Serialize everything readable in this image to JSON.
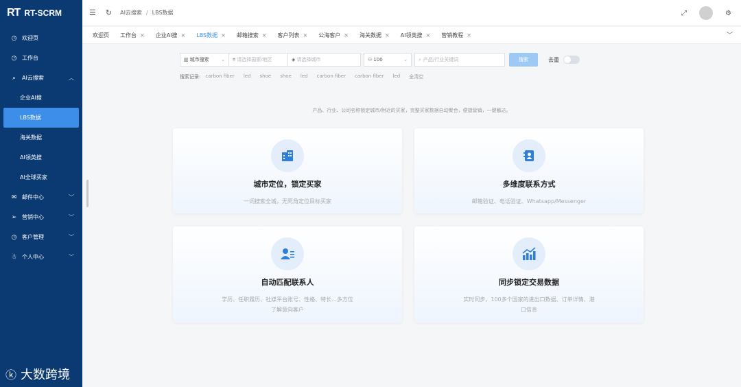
{
  "app": {
    "logo_mark": "RT",
    "logo_text": "RT-SCRM"
  },
  "sidebar": {
    "items": [
      {
        "label": "欢迎页",
        "icon": "clock-icon"
      },
      {
        "label": "工作台",
        "icon": "clock-icon"
      },
      {
        "label": "AI云搜索",
        "icon": "search-icon",
        "expanded": true
      },
      {
        "label": "企业AI搜"
      },
      {
        "label": "LBS数据",
        "active": true
      },
      {
        "label": "海关数据"
      },
      {
        "label": "AI领英搜"
      },
      {
        "label": "AI全球买家"
      },
      {
        "label": "邮件中心",
        "icon": "mail-icon"
      },
      {
        "label": "营销中心",
        "icon": "send-icon"
      },
      {
        "label": "客户管理",
        "icon": "clock-icon"
      },
      {
        "label": "个人中心",
        "icon": "person-icon"
      }
    ]
  },
  "topbar": {
    "breadcrumb": [
      "AI云搜索",
      "LBS数据"
    ]
  },
  "tabs": [
    {
      "label": "欢迎页",
      "closable": false
    },
    {
      "label": "工作台",
      "closable": true
    },
    {
      "label": "企业AI搜",
      "closable": true
    },
    {
      "label": "LBS数据",
      "closable": true,
      "active": true
    },
    {
      "label": "邮箱搜索",
      "closable": true
    },
    {
      "label": "客户列表",
      "closable": true
    },
    {
      "label": "公海客户",
      "closable": true
    },
    {
      "label": "海关数据",
      "closable": true
    },
    {
      "label": "AI领英搜",
      "closable": true
    },
    {
      "label": "营销教程",
      "closable": true
    }
  ],
  "search": {
    "mode_label": "城市搜索",
    "country_placeholder": "请选择国家/地区",
    "city_placeholder": "请选择城市",
    "count_value": "100",
    "keyword_placeholder": "产品/行业关键词",
    "search_button": "搜索",
    "dedup_label": "去重"
  },
  "history": {
    "label": "搜索记录:",
    "items": [
      "carbon fiber",
      "led",
      "shoe",
      "shoe",
      "led",
      "carbon fiber",
      "carbon fiber",
      "led"
    ],
    "clear": "全清空"
  },
  "intro": "产品、行业、公司名称锁定城市/附近的买家，完整买家数据自动聚合，便捷营销，一键触达。",
  "cards": [
    {
      "title": "城市定位，锁定买家",
      "desc": "一词搜索全城，无死角定位目标买家",
      "icon": "building-icon"
    },
    {
      "title": "多维度联系方式",
      "desc": "邮箱验证、电话验证、Whatsapp/Messenger",
      "icon": "contact-book-icon"
    },
    {
      "title": "自动匹配联系人",
      "desc": "学历、任职履历、社媒平台账号、性格、特长...多方位了解意向客户",
      "icon": "user-list-icon"
    },
    {
      "title": "同步锁定交易数据",
      "desc": "实时同步，100多个国家的进出口数据、订单详情、港口信息",
      "icon": "bar-chart-icon"
    }
  ],
  "watermark": "大数跨境",
  "colors": {
    "sidebar": "#0b3a72",
    "accent": "#3c8ee8",
    "button": "#9ec9f5"
  }
}
